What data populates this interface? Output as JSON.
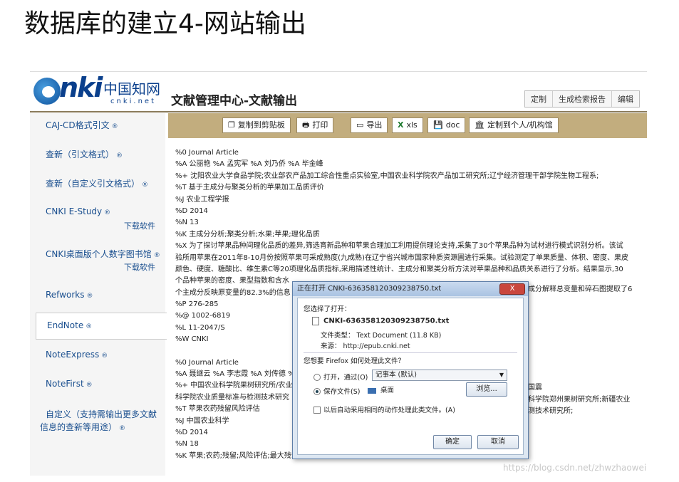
{
  "slide": {
    "title": "数据库的建立4-网站输出"
  },
  "header": {
    "logo_cn": "中国知网",
    "logo_net": "cnki.net",
    "heading": "文献管理中心-文献输出",
    "buttons": [
      "定制",
      "生成检索报告",
      "编辑"
    ]
  },
  "sidebar": {
    "items": [
      {
        "label": "CAJ-CD格式引文"
      },
      {
        "label": "查新（引文格式）"
      },
      {
        "label": "查新（自定义引文格式）"
      },
      {
        "label": "CNKI E-Study",
        "sub": "下载软件"
      },
      {
        "label": "CNKI桌面版个人数字图书馆",
        "sub": "下载软件"
      },
      {
        "label": "Refworks"
      },
      {
        "label": "EndNote"
      },
      {
        "label": "NoteExpress"
      },
      {
        "label": "NoteFirst"
      },
      {
        "label": "自定义（支持需输出更多文献",
        "label2": "信息的查新等用途）"
      }
    ],
    "reg": "®"
  },
  "toolbar": {
    "copy": "复制到剪贴板",
    "print": "打印",
    "export": "导出",
    "xls": "xls",
    "doc": "doc",
    "custom": "定制到个人/机构馆"
  },
  "records": {
    "r1": [
      "%0 Journal Article",
      "%A 公丽艳 %A 孟宪军 %A 刘乃侨 %A 毕金峰",
      "%+ 沈阳农业大学食品学院;农业部农产品加工综合性重点实验室,中国农业科学院农产品加工研究所;辽宁经济管理干部学院生物工程系;",
      "%T 基于主成分与聚类分析的苹果加工品质评价",
      "%J 农业工程学报",
      "%D 2014",
      "%N 13",
      "%K 主成分分析;聚类分析;水果;苹果;理化品质",
      "%X 为了探讨苹果品种间理化品质的差异,筛选育新品种和苹果合理加工利用提供理论支持,采集了30个苹果品种为试材进行模式识别分析。该试",
      "验所用苹果在2011年8-10月份按照苹果可采成熟度(九成熟)在辽宁省兴城市国家种质资源圃进行采集。试验测定了单果质量、体积、密度、果皮",
      "颜色、硬度、糖酸比、维生素C等20项理化品质指标,采用描述性统计、主成分和聚类分析方法对苹果品种和品质关系进行了分析。结果显示,30",
      "个品种苹果的密度、果型指数和含水",
      "个主成分反映原变量的82.3%的信息",
      "%P 276-285",
      "%@ 1002-6819",
      "%L 11-2047/S",
      "%W CNKI"
    ],
    "r1_tail": "成分解释总变量和碎石图提取了6",
    "r2": [
      "%0 Journal Article",
      "%A 聂继云 %A 李志霞 %A 刘传德 %",
      "%+ 中国农业科学院果树研究所/农业",
      "科学院农业质量标准与检测技术研究",
      "%T 苹果农药残留风险评估",
      "%J 中国农业科学",
      "%D 2014",
      "%N 18",
      "%K 苹果;农药;残留;风险评估;最大残留限量"
    ],
    "r2_tail1": "国震",
    "r2_tail2": "科学院郑州果树研究所;新疆农业",
    "r2_tail3": "测技术研究所;"
  },
  "dialog": {
    "title": "正在打开 CNKI-636358120309238750.txt",
    "close": "X",
    "chosen": "您选择了打开：",
    "filename": "CNKI-636358120309238750.txt",
    "filetype": "文件类型：  Text Document (11.8 KB)",
    "source": "来源：  http://epub.cnki.net",
    "question": "您想要 Firefox 如何处理此文件？",
    "open_with": "打开，通过(O)",
    "app": "记事本 (默认)",
    "save": "保存文件(S)",
    "location": "桌面",
    "browse": "浏览...",
    "remember": "以后自动采用相同的动作处理此类文件。(A)",
    "ok": "确定",
    "cancel": "取消"
  },
  "watermark": "https://blog.csdn.net/zhwzhaowei"
}
